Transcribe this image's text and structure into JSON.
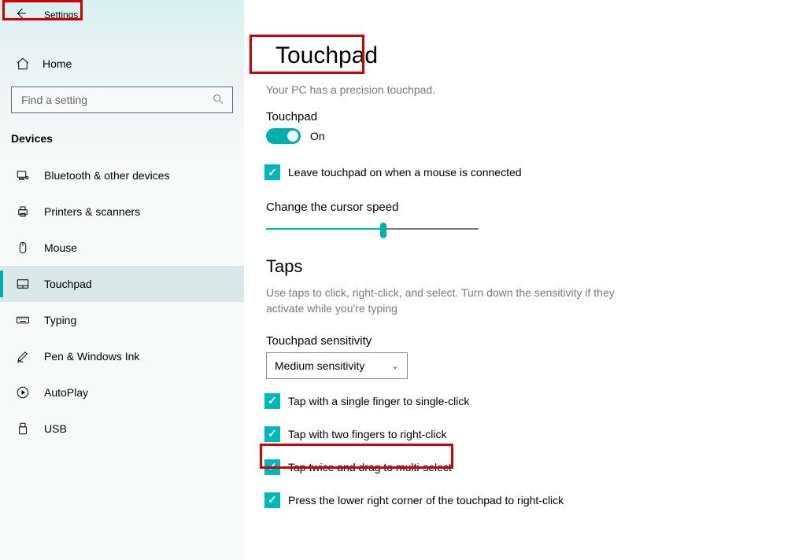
{
  "header": {
    "settings": "Settings"
  },
  "sidebar": {
    "home": "Home",
    "search_placeholder": "Find a setting",
    "section": "Devices",
    "items": [
      {
        "label": "Bluetooth & other devices"
      },
      {
        "label": "Printers & scanners"
      },
      {
        "label": "Mouse"
      },
      {
        "label": "Touchpad"
      },
      {
        "label": "Typing"
      },
      {
        "label": "Pen & Windows Ink"
      },
      {
        "label": "AutoPlay"
      },
      {
        "label": "USB"
      }
    ]
  },
  "main": {
    "title": "Touchpad",
    "precision": "Your PC has a precision touchpad.",
    "touchpad_label": "Touchpad",
    "toggle_state": "On",
    "leave_on": "Leave touchpad on when a mouse is connected",
    "cursor_speed_label": "Change the cursor speed",
    "cursor_speed_percent": 55,
    "taps_heading": "Taps",
    "taps_desc": "Use taps to click, right-click, and select. Turn down the sensitivity if they activate while you're typing",
    "sensitivity_label": "Touchpad sensitivity",
    "sensitivity_value": "Medium sensitivity",
    "tap_options": [
      "Tap with a single finger to single-click",
      "Tap with two fingers to right-click",
      "Tap twice and drag to multi-select",
      "Press the lower right corner of the touchpad to right-click"
    ]
  }
}
